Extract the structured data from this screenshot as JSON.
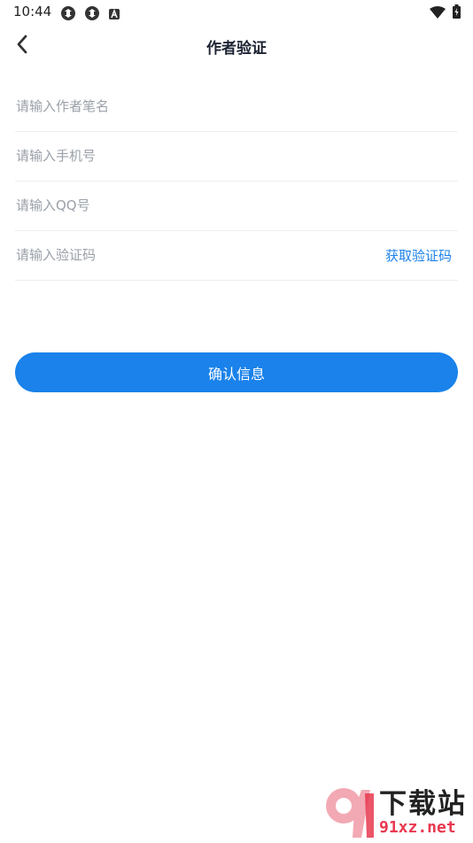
{
  "status_bar": {
    "time": "10:44",
    "left_icons": [
      "sync-icon",
      "sync-icon",
      "notification-a-icon"
    ],
    "right_icons": [
      "wifi-icon",
      "battery-icon"
    ]
  },
  "nav": {
    "back_icon": "chevron-left-icon",
    "title": "作者验证"
  },
  "form": {
    "pen_name_placeholder": "请输入作者笔名",
    "phone_placeholder": "请输入手机号",
    "qq_placeholder": "请输入QQ号",
    "code_placeholder": "请输入验证码",
    "get_code_label": "获取验证码"
  },
  "confirm_label": "确认信息",
  "watermark": {
    "title": "下载站",
    "url": "91xz.net"
  },
  "colors": {
    "accent": "#1a82ea",
    "title_text": "#1c2333",
    "placeholder": "#9aa0a8",
    "divider": "#eceef1",
    "watermark_red": "#e8384f"
  }
}
